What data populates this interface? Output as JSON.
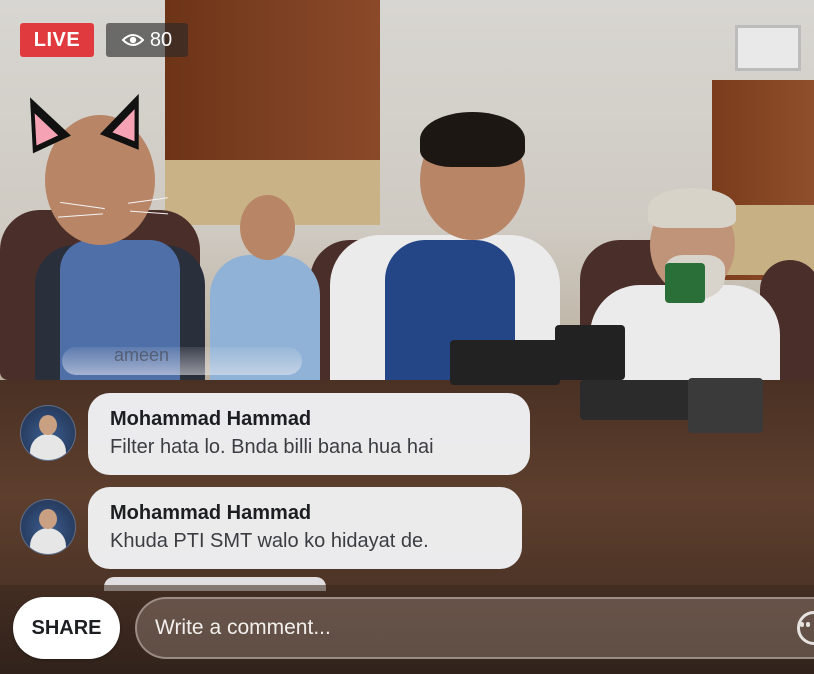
{
  "live": {
    "badge_label": "LIVE",
    "viewer_count": "80"
  },
  "faded_comment": {
    "text": "ameen"
  },
  "comments": [
    {
      "author": "Mohammad Hammad",
      "text": "Filter hata lo. Bnda billi bana hua hai"
    },
    {
      "author": "Mohammad Hammad",
      "text": "Khuda PTI SMT walo ko hidayat de."
    }
  ],
  "footer": {
    "share_label": "SHARE",
    "comment_placeholder": "Write a comment..."
  },
  "icons": {
    "viewers": "eye-icon",
    "emoji": "smiley-icon"
  },
  "colors": {
    "live_red": "#e0393e",
    "bubble_bg": "#f1f1f3",
    "share_bg": "#ffffff"
  }
}
